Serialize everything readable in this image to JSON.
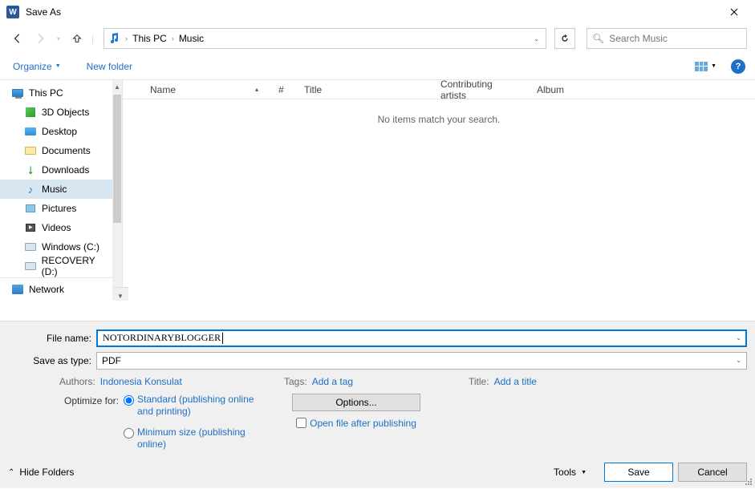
{
  "title": "Save As",
  "breadcrumb": {
    "root": "This PC",
    "current": "Music"
  },
  "search": {
    "placeholder": "Search Music"
  },
  "toolbar": {
    "organize": "Organize",
    "newfolder": "New folder"
  },
  "tree": {
    "thispc": "This PC",
    "objects3d": "3D Objects",
    "desktop": "Desktop",
    "documents": "Documents",
    "downloads": "Downloads",
    "music": "Music",
    "pictures": "Pictures",
    "videos": "Videos",
    "drivec": "Windows (C:)",
    "drived": "RECOVERY (D:)",
    "network": "Network"
  },
  "columns": {
    "name": "Name",
    "num": "#",
    "title": "Title",
    "artists": "Contributing artists",
    "album": "Album"
  },
  "empty": "No items match your search.",
  "form": {
    "filename_label": "File name:",
    "filename_value": "NOTORDINARYBLOGGER",
    "saveas_label": "Save as type:",
    "saveas_value": "PDF",
    "authors_label": "Authors:",
    "authors_value": "Indonesia Konsulat",
    "tags_label": "Tags:",
    "tags_value": "Add a tag",
    "title_label": "Title:",
    "title_value": "Add a title",
    "optimize_label": "Optimize for:",
    "radio_standard": "Standard (publishing online and printing)",
    "radio_minimum": "Minimum size (publishing online)",
    "options_btn": "Options...",
    "open_after": "Open file after publishing"
  },
  "footer": {
    "hide": "Hide Folders",
    "tools": "Tools",
    "save": "Save",
    "cancel": "Cancel"
  }
}
